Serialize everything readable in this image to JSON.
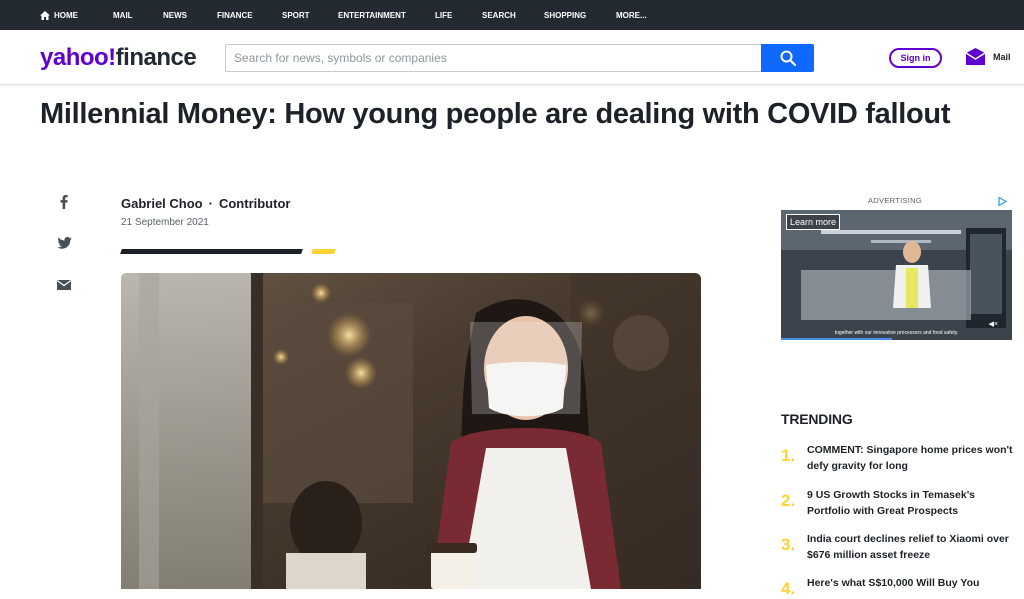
{
  "topnav": {
    "items": [
      "HOME",
      "MAIL",
      "NEWS",
      "FINANCE",
      "SPORT",
      "ENTERTAINMENT",
      "LIFE",
      "SEARCH",
      "SHOPPING",
      "MORE..."
    ]
  },
  "header": {
    "logo_yahoo": "yahoo!",
    "logo_finance": "finance",
    "search_placeholder": "Search for news, symbols or companies",
    "signin_label": "Sign in",
    "mail_label": "Mail"
  },
  "article": {
    "headline": "Millennial Money: How young people are dealing with COVID fallout",
    "author": "Gabriel Choo",
    "role": "Contributor",
    "date": "21 September 2021"
  },
  "share": {
    "icons": [
      "facebook-icon",
      "twitter-icon",
      "email-icon"
    ]
  },
  "ad": {
    "label": "ADVERTISING",
    "learn_more": "Learn more",
    "caption": "together with our innovative processors and food safety."
  },
  "trending": {
    "title": "TRENDING",
    "items": [
      {
        "num": "1.",
        "text": "COMMENT: Singapore home prices won't defy gravity for long"
      },
      {
        "num": "2.",
        "text": "9 US Growth Stocks in Temasek's Portfolio with Great Prospects"
      },
      {
        "num": "3.",
        "text": "India court declines relief to Xiaomi over $676 million asset freeze"
      },
      {
        "num": "4.",
        "text": "Here's what S$10,000 Will Buy You"
      }
    ]
  },
  "colors": {
    "nav_bg": "#232a31",
    "brand_purple": "#6001d2",
    "search_blue": "#0f69ff",
    "accent_yellow": "#ffd333"
  }
}
